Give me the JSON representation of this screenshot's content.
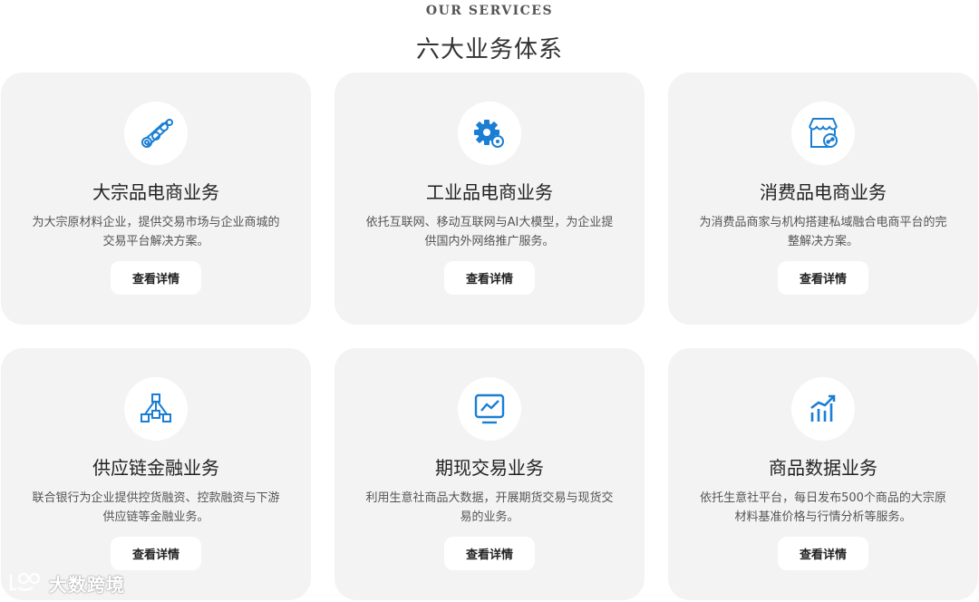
{
  "header": {
    "eyebrow": "OUR SERVICES",
    "title": "六大业务体系"
  },
  "colors": {
    "accent": "#1a7fd4",
    "card_bg": "#f3f3f3"
  },
  "cards": [
    {
      "icon": "stacked-coins-icon",
      "title": "大宗品电商业务",
      "description": "为大宗原材料企业，提供交易市场与企业商城的交易平台解决方案。",
      "button": "查看详情"
    },
    {
      "icon": "gear-icon",
      "title": "工业品电商业务",
      "description": "依托互联网、移动互联网与AI大模型，为企业提供国内外网络推广服务。",
      "button": "查看详情"
    },
    {
      "icon": "storefront-icon",
      "title": "消费品电商业务",
      "description": "为消费品商家与机构搭建私域融合电商平台的完整解决方案。",
      "button": "查看详情"
    },
    {
      "icon": "supply-chain-network-icon",
      "title": "供应链金融业务",
      "description": "联合银行为企业提供控货融资、控款融资与下游供应链等金融业务。",
      "button": "查看详情"
    },
    {
      "icon": "trend-monitor-icon",
      "title": "期现交易业务",
      "description": "利用生意社商品大数据，开展期货交易与现货交易的业务。",
      "button": "查看详情"
    },
    {
      "icon": "bar-chart-icon",
      "title": "商品数据业务",
      "description": "依托生意社平台，每日发布500个商品的大宗原材料基准价格与行情分析等服务。",
      "button": "查看详情"
    }
  ],
  "watermark": {
    "text": "大数跨境"
  }
}
